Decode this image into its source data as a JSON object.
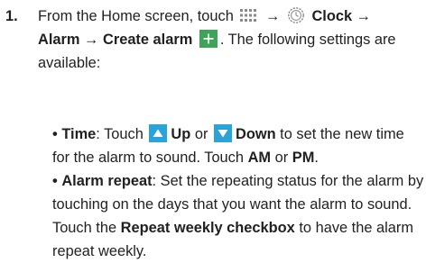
{
  "step": {
    "number": "1.",
    "line1": {
      "prefix": "From the Home screen, touch",
      "arrow1": "→",
      "clock_label": "Clock",
      "arrow2": "→"
    },
    "line2": {
      "alarm": "Alarm",
      "arrow": "→",
      "create_alarm": "Create alarm",
      "suffix": ". The following settings are"
    },
    "line3": "available:"
  },
  "bullets": [
    {
      "bullet": "•",
      "term": "Time",
      "colon": ":",
      "touch1": "Touch",
      "up": "Up",
      "or1": "or",
      "down": "Down",
      "rest1": "to set the new time",
      "line2a": "for the alarm to sound. Touch",
      "am": "AM",
      "or2": "or",
      "pm": "PM",
      "period": "."
    },
    {
      "bullet": "•",
      "term": "Alarm repeat",
      "line1rest": ": Set the repeating status for the alarm by",
      "line2": "touching on the days that you want the alarm to sound.",
      "line3a": "Touch the",
      "checkbox_label": "Repeat weekly checkbox",
      "line3b": "to have the alarm",
      "line4": "repeat weekly."
    }
  ],
  "icons": {
    "apps": "apps-grid-icon",
    "clock": "clock-icon",
    "plus": "plus-icon",
    "up": "up-arrow-icon",
    "down": "down-arrow-icon"
  },
  "colors": {
    "plus_bg": "#3fa35a",
    "arrow_bg": "#2aa3d8",
    "text": "#231f20"
  }
}
